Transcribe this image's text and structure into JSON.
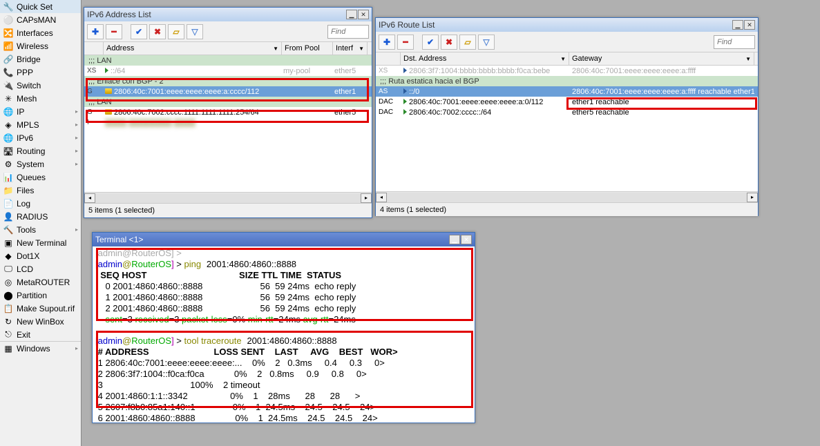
{
  "sidebar": {
    "items": [
      {
        "label": "Quick Set",
        "icon": "🔧"
      },
      {
        "label": "CAPsMAN",
        "icon": "⚪"
      },
      {
        "label": "Interfaces",
        "icon": "🔀"
      },
      {
        "label": "Wireless",
        "icon": "📶"
      },
      {
        "label": "Bridge",
        "icon": "🔗"
      },
      {
        "label": "PPP",
        "icon": "📞"
      },
      {
        "label": "Switch",
        "icon": "🔌"
      },
      {
        "label": "Mesh",
        "icon": "✳"
      },
      {
        "label": "IP",
        "icon": "🌐",
        "sub": true
      },
      {
        "label": "MPLS",
        "icon": "◈",
        "sub": true
      },
      {
        "label": "IPv6",
        "icon": "🌐",
        "sub": true
      },
      {
        "label": "Routing",
        "icon": "🛣",
        "sub": true
      },
      {
        "label": "System",
        "icon": "⚙",
        "sub": true
      },
      {
        "label": "Queues",
        "icon": "📊"
      },
      {
        "label": "Files",
        "icon": "📁"
      },
      {
        "label": "Log",
        "icon": "📄"
      },
      {
        "label": "RADIUS",
        "icon": "👤"
      },
      {
        "label": "Tools",
        "icon": "🔨",
        "sub": true
      },
      {
        "label": "New Terminal",
        "icon": "▣"
      },
      {
        "label": "Dot1X",
        "icon": "◆"
      },
      {
        "label": "LCD",
        "icon": "🖵"
      },
      {
        "label": "MetaROUTER",
        "icon": "◎"
      },
      {
        "label": "Partition",
        "icon": "⬤"
      },
      {
        "label": "Make Supout.rif",
        "icon": "📋"
      },
      {
        "label": "New WinBox",
        "icon": "↻"
      },
      {
        "label": "Exit",
        "icon": "⎋"
      }
    ],
    "windows_label": "Windows"
  },
  "addr_win": {
    "title": "IPv6 Address List",
    "find": "Find",
    "cols": {
      "address": "Address",
      "frompool": "From Pool",
      "iface": "Interf"
    },
    "rows": [
      {
        "flag": "",
        "type": "comment",
        "text": ";;; LAN"
      },
      {
        "flag": "XS",
        "addr": "::/64",
        "pool": "my-pool",
        "iface": "ether5",
        "gray": true
      },
      {
        "flag": "",
        "type": "comment",
        "text": ";;; Enlace con BGP - 2"
      },
      {
        "flag": "G",
        "addr": "2806:40c:7001:eeee:eeee:eeee:a:cccc/112",
        "pool": "",
        "iface": "ether1",
        "selected": true,
        "tri": "y"
      },
      {
        "flag": "",
        "type": "comment",
        "text": ";;; LAN"
      },
      {
        "flag": "G",
        "addr": "2806:40c:7002:cccc:1111:1111:1111:254/64",
        "pool": "",
        "iface": "ether5",
        "tri": "y"
      },
      {
        "flag": "I",
        "addr": "",
        "gray": true,
        "blur": true
      }
    ],
    "status": "5 items (1 selected)"
  },
  "route_win": {
    "title": "IPv6 Route List",
    "find": "Find",
    "cols": {
      "dst": "Dst. Address",
      "gw": "Gateway"
    },
    "rows": [
      {
        "flag": "XS",
        "dst": "2806:3f7:1004:bbbb:bbbb:bbbb:f0ca:bebe",
        "gw": "2806:40c:7001:eeee:eeee:eeee:a:ffff",
        "gray": true,
        "tri": "blue"
      },
      {
        "flag": "",
        "type": "comment",
        "text": ";;; Ruta estatica hacia el BGP"
      },
      {
        "flag": "AS",
        "dst": "::/0",
        "gw": "2806:40c:7001:eeee:eeee:eeee:a:ffff reachable ether1",
        "selected": true,
        "tri": "blue"
      },
      {
        "flag": "DAC",
        "dst": "2806:40c:7001:eeee:eeee:eeee:a:0/112",
        "gw": "ether1 reachable",
        "tri": "green"
      },
      {
        "flag": "DAC",
        "dst": "2806:40c:7002:cccc::/64",
        "gw": "ether5 reachable",
        "tri": "green"
      }
    ],
    "status": "4 items (1 selected)"
  },
  "term_win": {
    "title": "Terminal <1>",
    "prompt_user": "admin",
    "prompt_host": "RouterOS",
    "ping_cmd": "ping",
    "ping_target": "2001:4860:4860::8888",
    "ping_header": "  SEQ HOST                                     SIZE TTL TIME  STATUS",
    "ping_rows": [
      "    0 2001:4860:4860::8888                       56  59 24ms  echo reply",
      "    1 2001:4860:4860::8888                       56  59 24ms  echo reply",
      "    2 2001:4860:4860::8888                       56  59 24ms  echo reply"
    ],
    "ping_summary_pre": "    ",
    "ping_sent": "sent",
    "ping_sent_v": "=3 ",
    "ping_recv": "received",
    "ping_recv_v": "=3 ",
    "ping_loss": "packet-loss",
    "ping_loss_v": "=0% ",
    "ping_minrtt": "min-rtt",
    "ping_minrtt_v": "=24ms ",
    "ping_avgrtt": "avg-rtt",
    "ping_avgrtt_v": "=24ms",
    "tr_cmd": "tool traceroute",
    "tr_target": "2001:4860:4860::8888",
    "tr_header": " # ADDRESS                          LOSS SENT    LAST     AVG    BEST   WOR>",
    "tr_rows": [
      " 1 2806:40c:7001:eeee:eeee:eeee:...    0%    2   0.3ms     0.4     0.3     0>",
      " 2 2806:3f7:1004::f0ca:f0ca            0%    2   0.8ms     0.9     0.8     0>",
      " 3                                   100%    2 timeout",
      " 4 2001:4860:1:1::3342                 0%    1    28ms      28      28      >",
      " 5 2607:f8b0:85a1:140::1               0%    1  24.5ms    24.5    24.5    24>",
      " 6 2001:4860:4860::8888                0%    1  24.5ms    24.5    24.5    24>"
    ]
  }
}
